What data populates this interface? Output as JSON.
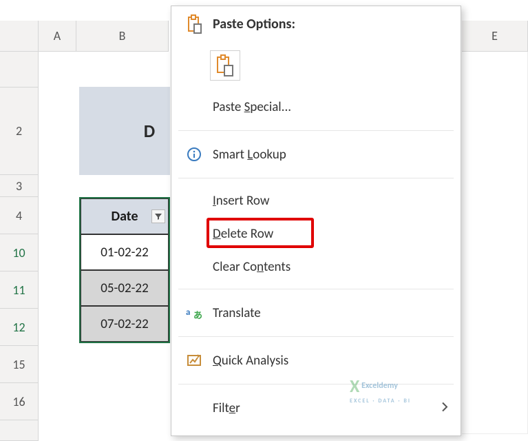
{
  "columns": {
    "A": "A",
    "B": "B",
    "E": "E"
  },
  "visible_rows": [
    "2",
    "3",
    "4",
    "10",
    "11",
    "12",
    "15",
    "16"
  ],
  "selected_rows": [
    "10",
    "11",
    "12"
  ],
  "title_cell": "D",
  "table": {
    "header": "Date",
    "rows": [
      "01-02-22",
      "05-02-22",
      "07-02-22"
    ]
  },
  "menu": {
    "paste_options_label": "Paste Options:",
    "paste_special": "Paste Special...",
    "smart_lookup": "Smart Lookup",
    "insert_row": "Insert Row",
    "delete_row": "Delete Row",
    "clear_contents": "Clear Contents",
    "translate": "Translate",
    "quick_analysis": "Quick Analysis",
    "filter": "Filter"
  },
  "watermark": {
    "brand": "Exceldemy",
    "tag": "EXCEL · DATA · BI"
  }
}
